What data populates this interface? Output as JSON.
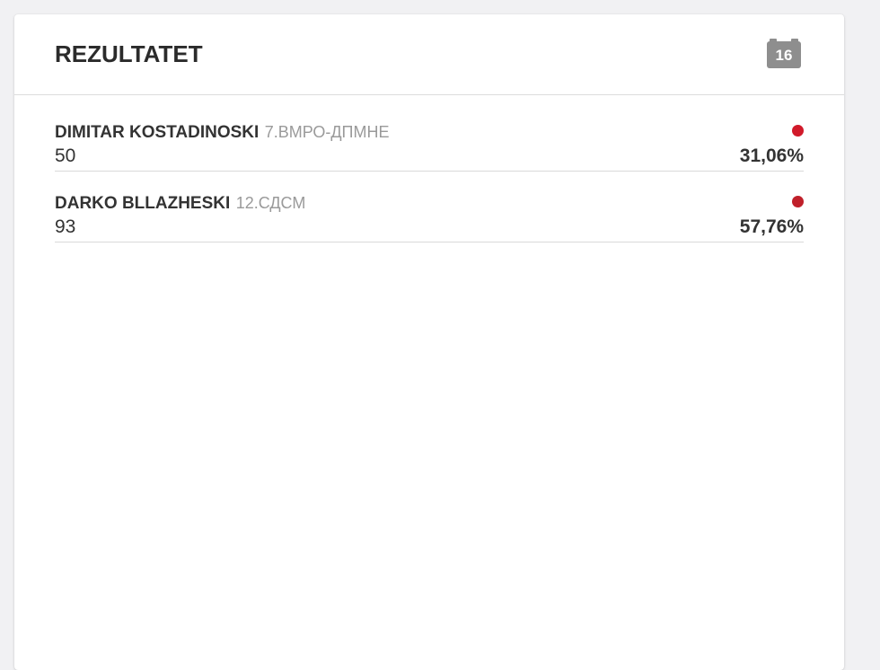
{
  "panel": {
    "title": "REZULTATET",
    "badge": "16"
  },
  "results": [
    {
      "candidate": "DIMITAR KOSTADINOSKI",
      "party": "7.ВМРО-ДПМНЕ",
      "votes": "50",
      "percent": "31,06%",
      "dot_color": "#d11a2a"
    },
    {
      "candidate": "DARKO BLLAZHESKI",
      "party": "12.СДСМ",
      "votes": "93",
      "percent": "57,76%",
      "dot_color": "#c0202a"
    }
  ]
}
